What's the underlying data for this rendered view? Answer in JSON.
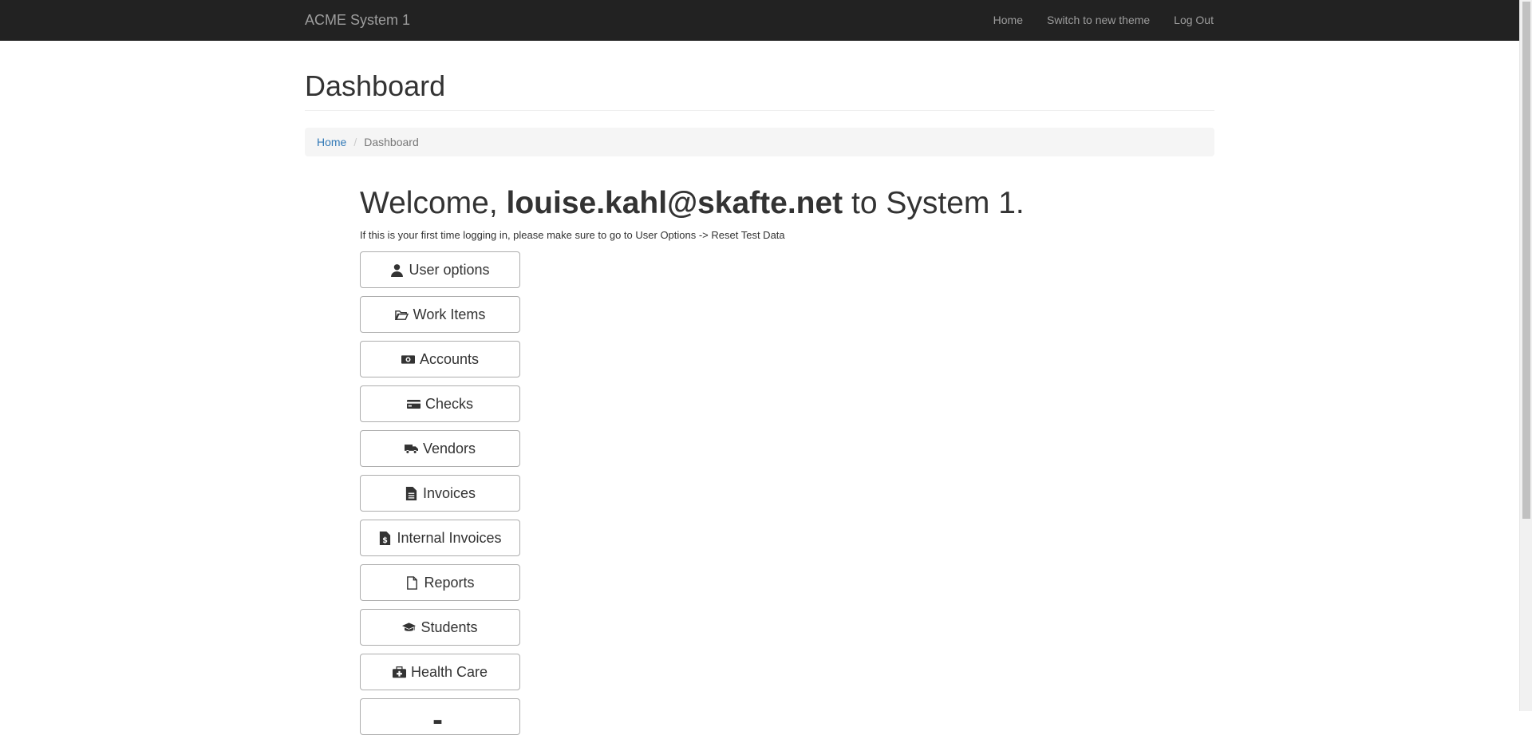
{
  "navbar": {
    "brand": "ACME System 1",
    "links": [
      {
        "label": "Home"
      },
      {
        "label": "Switch to new theme"
      },
      {
        "label": "Log Out"
      }
    ]
  },
  "page": {
    "title": "Dashboard"
  },
  "breadcrumb": {
    "home": "Home",
    "current": "Dashboard"
  },
  "welcome": {
    "prefix": "Welcome, ",
    "user": "louise.kahl@skafte.net",
    "suffix": " to System 1.",
    "hint": "If this is your first time logging in, please make sure to go to User Options -> Reset Test Data"
  },
  "menu_buttons": [
    {
      "label": "User options",
      "icon": "user-icon"
    },
    {
      "label": "Work Items",
      "icon": "folder-open-icon"
    },
    {
      "label": "Accounts",
      "icon": "money-icon"
    },
    {
      "label": "Checks",
      "icon": "credit-card-icon"
    },
    {
      "label": "Vendors",
      "icon": "truck-icon"
    },
    {
      "label": "Invoices",
      "icon": "file-text-icon"
    },
    {
      "label": "Internal Invoices",
      "icon": "file-invoice-dollar-icon"
    },
    {
      "label": "Reports",
      "icon": "file-icon"
    },
    {
      "label": "Students",
      "icon": "graduation-cap-icon"
    },
    {
      "label": "Health Care",
      "icon": "medkit-icon"
    },
    {
      "label": "",
      "icon": "partial-icon"
    }
  ],
  "colors": {
    "navbar_bg": "#222222",
    "nav_text": "#9d9d9d",
    "link": "#337ab7",
    "breadcrumb_bg": "#f5f5f5"
  }
}
